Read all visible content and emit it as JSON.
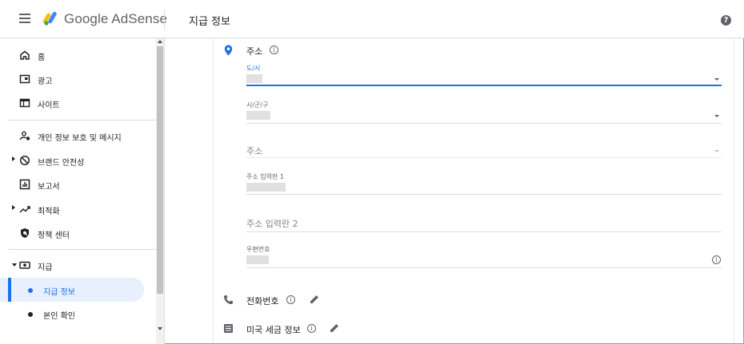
{
  "header": {
    "brand": "Google AdSense",
    "title": "지급 정보",
    "help": "?"
  },
  "sidebar": {
    "items": [
      {
        "label": "홈",
        "icon": "home-icon"
      },
      {
        "label": "광고",
        "icon": "ads-icon"
      },
      {
        "label": "사이트",
        "icon": "sites-icon"
      },
      {
        "label": "개인 정보 보호 및 메시지",
        "icon": "privacy-icon"
      },
      {
        "label": "브랜드 안전성",
        "icon": "block-icon"
      },
      {
        "label": "보고서",
        "icon": "reports-icon"
      },
      {
        "label": "최적화",
        "icon": "trending-icon"
      },
      {
        "label": "정책 센터",
        "icon": "policy-shield-icon"
      },
      {
        "label": "지급",
        "icon": "payments-icon"
      }
    ],
    "sub_items": [
      {
        "label": "지급 정보",
        "active": true
      },
      {
        "label": "본인 확인",
        "active": false
      }
    ]
  },
  "address": {
    "title": "주소",
    "fields": {
      "province_label": "도/시",
      "city_label": "시/군/구",
      "address_placeholder": "주소",
      "line1_label": "주소 입력란 1",
      "line2_placeholder": "주소 입력란 2",
      "postal_label": "우편번호"
    }
  },
  "phone": {
    "title": "전화번호"
  },
  "tax": {
    "title": "미국 세금 정보"
  },
  "colors": {
    "accent": "#1a73e8",
    "active_bg": "#e8f0fe",
    "text": "#202124",
    "muted": "#5f6368"
  }
}
